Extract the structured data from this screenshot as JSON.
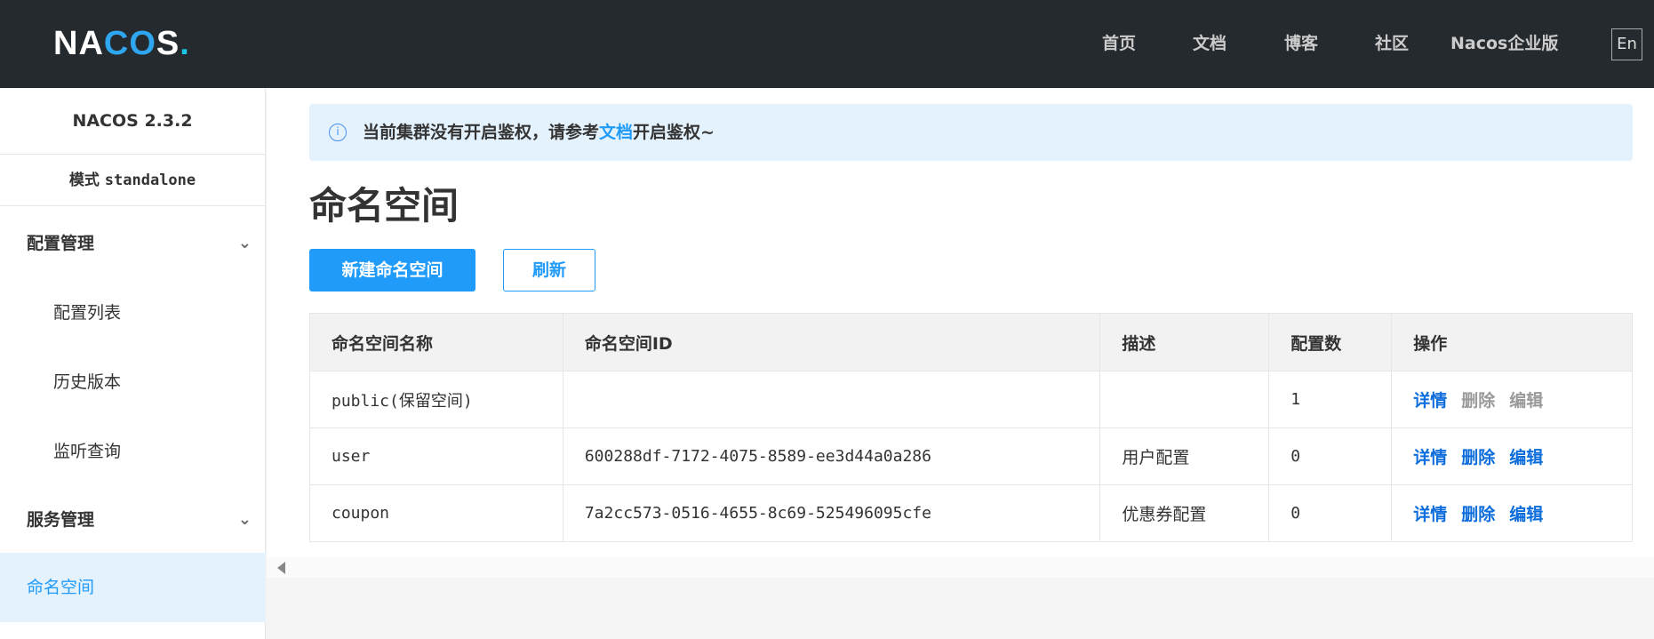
{
  "header": {
    "logo": "NACOS.",
    "nav": [
      "首页",
      "文档",
      "博客",
      "社区",
      "Nacos企业版"
    ],
    "lang": "En"
  },
  "sidebar": {
    "version": "NACOS 2.3.2",
    "mode_label": "模式",
    "mode_value": "standalone",
    "groups": [
      {
        "label": "配置管理",
        "items": [
          "配置列表",
          "历史版本",
          "监听查询"
        ]
      },
      {
        "label": "服务管理"
      }
    ],
    "active": "命名空间"
  },
  "alert": {
    "prefix": "当前集群没有开启鉴权，请参考",
    "link": "文档",
    "suffix": "开启鉴权~"
  },
  "page": {
    "title": "命名空间",
    "new_button": "新建命名空间",
    "refresh_button": "刷新"
  },
  "table": {
    "headers": [
      "命名空间名称",
      "命名空间ID",
      "描述",
      "配置数",
      "操作"
    ],
    "rows": [
      {
        "name": "public(保留空间)",
        "id": "",
        "desc": "",
        "count": "1",
        "ops": [
          "详情",
          "删除",
          "编辑"
        ],
        "disabled": true
      },
      {
        "name": "user",
        "id": "600288df-7172-4075-8589-ee3d44a0a286",
        "desc": "用户配置",
        "count": "0",
        "ops": [
          "详情",
          "删除",
          "编辑"
        ]
      },
      {
        "name": "coupon",
        "id": "7a2cc573-0516-4655-8c69-525496095cfe",
        "desc": "优惠券配置",
        "count": "0",
        "ops": [
          "详情",
          "删除",
          "编辑"
        ]
      }
    ]
  }
}
